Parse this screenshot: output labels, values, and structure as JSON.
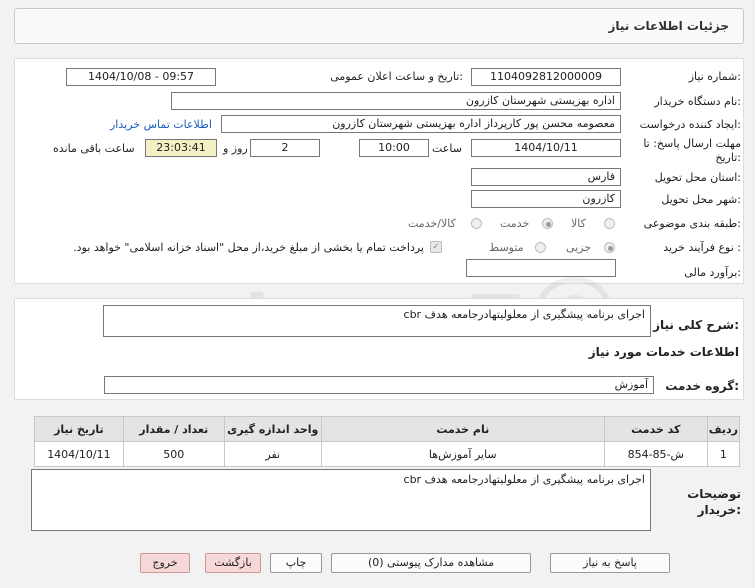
{
  "header": {
    "title": "جزئیات اطلاعات نیاز"
  },
  "form": {
    "need_number_label": "شماره نیاز:",
    "need_number": "1104092812000009",
    "announce_label": "تاریخ و ساعت اعلان عمومی:",
    "announce_value": "1404/10/08 - 09:57",
    "buyer_org_label": "نام دستگاه خریدار:",
    "buyer_org": "اداره بهزیستی شهرستان کازرون",
    "creator_label": "ایجاد کننده درخواست:",
    "creator": "معصومه محسن پور کارپرداز اداره بهزیستی شهرستان کازرون",
    "contact_link": "اطلاعات تماس خریدار",
    "deadline_label": "مهلت ارسال پاسخ: تا تاریخ:",
    "deadline_date": "1404/10/11",
    "time_label": "ساعت",
    "deadline_time": "10:00",
    "days_value": "2",
    "days_label": "روز و",
    "remaining_value": "23:03:41",
    "remaining_label": "ساعت باقی مانده",
    "province_label": "استان محل تحویل:",
    "province": "فارس",
    "city_label": "شهر محل تحویل:",
    "city": "کازرون",
    "category_label": "طبقه بندی موضوعی:",
    "category_options": [
      "کالا",
      "خدمت",
      "کالا/خدمت"
    ],
    "category_selected": "خدمت",
    "process_label": "نوع فرآیند خرید :",
    "process_options": [
      "جزیی",
      "متوسط"
    ],
    "process_selected": "جزیی",
    "payment_note": "پرداخت تمام یا بخشی از مبلغ خرید،از محل \"اسناد خزانه اسلامی\" خواهد بود.",
    "budget_label": "برآورد مالی:",
    "budget_value": ""
  },
  "need": {
    "summary_label": "شرح کلی نیاز:",
    "summary": "اجرای برنامه پیشگیری از معلولیتهادرجامعه هدف cbr",
    "services_title": "اطلاعات خدمات مورد نیاز",
    "service_group_label": "گروه خدمت:",
    "service_group": "آموزش"
  },
  "table": {
    "headers": [
      "ردیف",
      "کد خدمت",
      "نام خدمت",
      "واحد اندازه گیری",
      "تعداد / مقدار",
      "تاریخ نیاز"
    ],
    "rows": [
      [
        "1",
        "ش-85-854",
        "سایر آموزش‌ها",
        "نفر",
        "500",
        "1404/10/11"
      ]
    ]
  },
  "notes": {
    "label": "توضیحات خریدار:",
    "text": "اجرای برنامه پیشگیری از معلولیتهادرجامعه هدف cbr"
  },
  "buttons": {
    "reply": "پاسخ به نیاز",
    "view_docs": "مشاهده مدارک پیوستی (0)",
    "print": "چاپ",
    "back": "بازگشت",
    "exit": "خروج"
  }
}
